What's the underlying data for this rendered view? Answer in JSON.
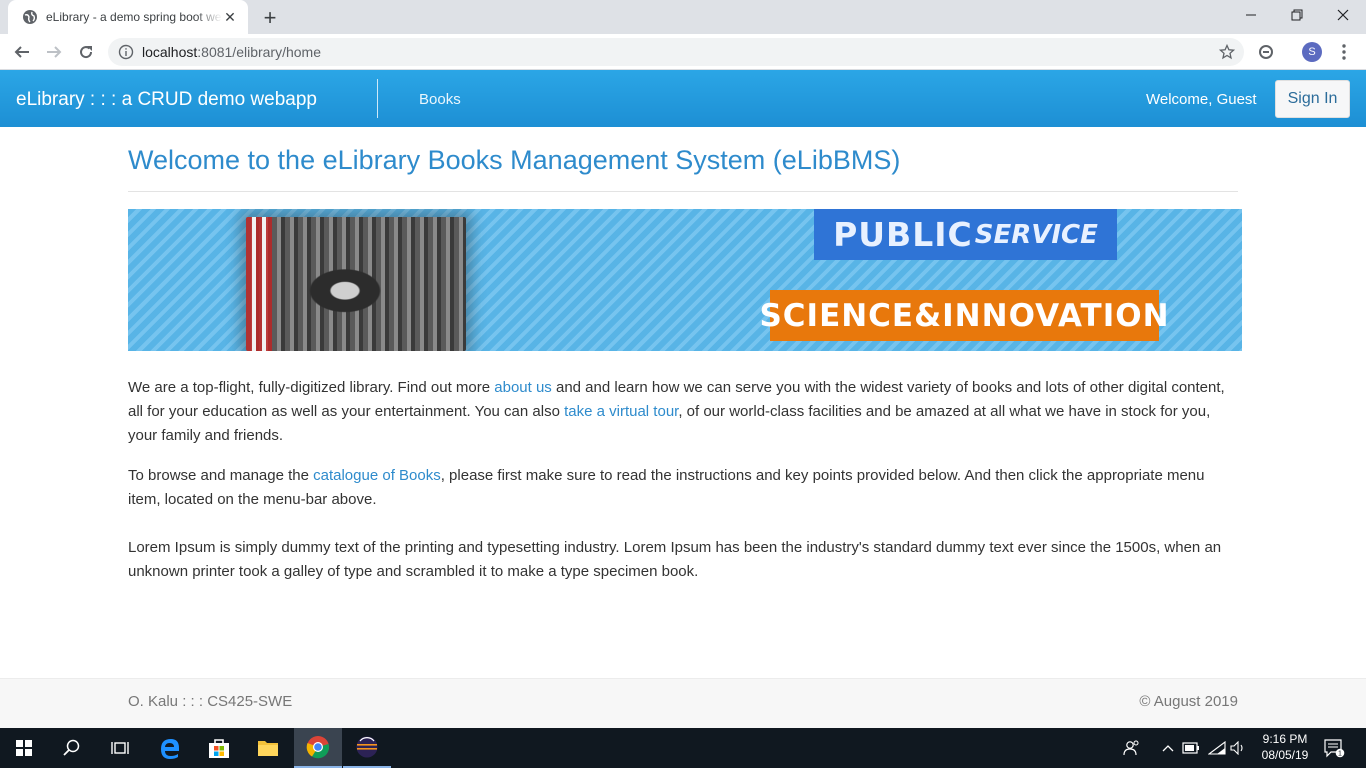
{
  "browser": {
    "tab_title": "eLibrary - a demo spring boot webapp",
    "url_host": "localhost",
    "url_rest": ":8081/elibrary/home",
    "profile_initial": "S"
  },
  "navbar": {
    "brand": "eLibrary : : : a CRUD demo webapp",
    "books_link": "Books",
    "welcome": "Welcome, Guest",
    "signin_label": "Sign In"
  },
  "main": {
    "title": "Welcome to the eLibrary Books Management System (eLibBMS)",
    "banner": {
      "public_bold": "PUBLIC",
      "public_italic": "SERVICE",
      "science": "SCIENCE&INNOVATION"
    },
    "para1": {
      "t1": "We are a top-flight, fully-digitized library. Find out more ",
      "link1": "about us",
      "t2": " and and learn how we can serve you with the widest variety of books and lots of other digital content, all for your education as well as your entertainment. You can also ",
      "link2": "take a virtual tour",
      "t3": ", of our world-class facilities and be amazed at all what we have in stock for you, your family and friends."
    },
    "para2": {
      "t1": "To browse and manage the ",
      "link1": "catalogue of Books",
      "t2": ", please first make sure to read the instructions and key points provided below. And then click the appropriate menu item, located on the menu-bar above."
    },
    "para3": "Lorem Ipsum is simply dummy text of the printing and typesetting industry. Lorem Ipsum has been the industry's standard dummy text ever since the 1500s, when an unknown printer took a galley of type and scrambled it to make a type specimen book."
  },
  "footer": {
    "left": "O. Kalu : : : CS425-SWE",
    "right": "© August 2019"
  },
  "taskbar": {
    "time": "9:16 PM",
    "date": "08/05/19",
    "notification_count": "1"
  },
  "colors": {
    "navbar": "#1d8fd4",
    "title": "#2e8bcc",
    "link": "#2e8bcc"
  }
}
